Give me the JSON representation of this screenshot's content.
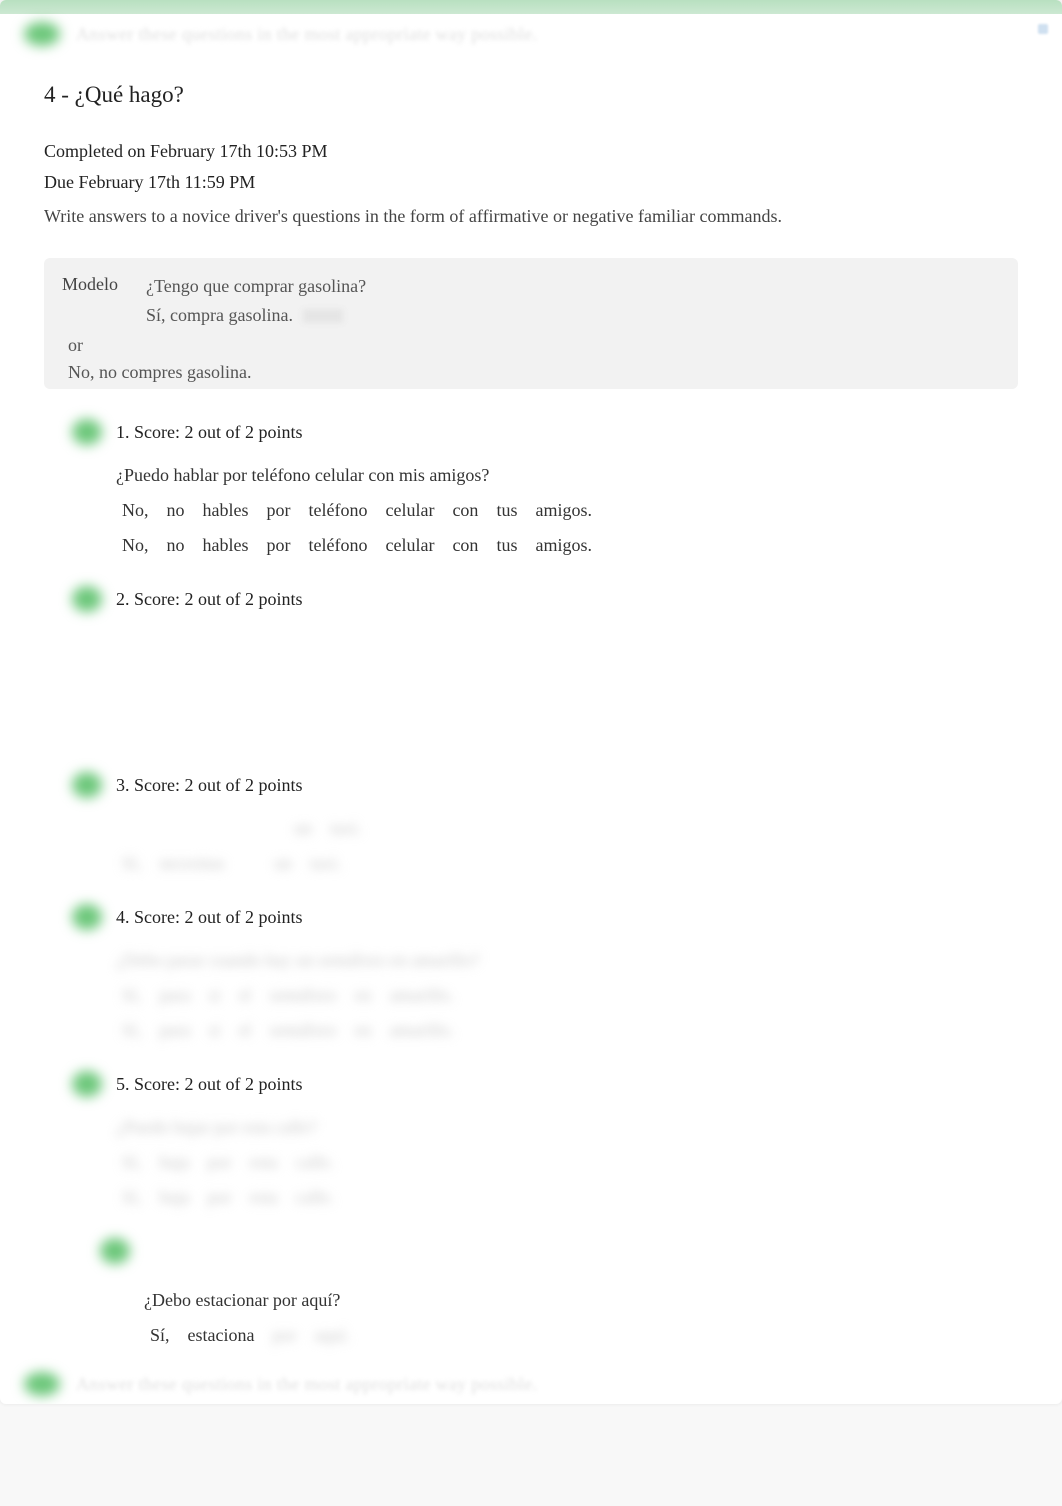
{
  "banner": {
    "text1": "Answer these questions in the most appropriate way possible.",
    "text2": "Answer these questions in the most appropriate way possible."
  },
  "title": "4 - ¿Qué hago?",
  "meta": {
    "completed": "Completed on February 17th 10:53 PM",
    "due": "Due February 17th 11:59 PM",
    "instructions": "Write answers to a novice driver's questions in the form of affirmative or negative familiar commands."
  },
  "modelo": {
    "label": "Modelo",
    "question": "¿Tengo que comprar gasolina?",
    "aff": "Sí, compra gasolina.",
    "or": "or",
    "neg": "No, no compres gasolina."
  },
  "questions": [
    {
      "num": "1.",
      "score": "Score: 2 out of 2 points",
      "prompt": "¿Puedo hablar por teléfono celular con mis amigos?",
      "answers": [
        [
          "No,",
          "no",
          "hables",
          "por",
          "teléfono",
          "celular",
          "con",
          "tus",
          "amigos."
        ],
        [
          "No,",
          "no",
          "hables",
          "por",
          "teléfono",
          "celular",
          "con",
          "tus",
          "amigos."
        ]
      ],
      "blurred_prompt": false,
      "blurred_answers": false
    },
    {
      "num": "2.",
      "score": "Score: 2 out of 2 points",
      "prompt": "",
      "answers": [],
      "blurred_prompt": false,
      "blurred_answers": false,
      "spacer": true
    },
    {
      "num": "3.",
      "score": "Score: 2 out of 2 points",
      "prompt": "",
      "answers": [
        [
          "",
          "",
          "",
          "",
          "un",
          "taxi."
        ],
        [
          "Sí,",
          "necesitas",
          "",
          "un",
          "taxi."
        ]
      ],
      "blurred_prompt": true,
      "blurred_answers": true,
      "leading_blur": true
    },
    {
      "num": "4.",
      "score": "Score: 2 out of 2 points",
      "prompt": "¿Debo parar cuando hay un semáforo en amarillo?",
      "answers": [
        [
          "Sí,",
          "para",
          "si",
          "el",
          "semáforo",
          "en",
          "amarillo."
        ],
        [
          "Sí,",
          "para",
          "si",
          "el",
          "semáforo",
          "en",
          "amarillo."
        ]
      ],
      "blurred_prompt": true,
      "blurred_answers": true
    },
    {
      "num": "5.",
      "score": "Score: 2 out of 2 points",
      "prompt": "¿Puedo bajar por esta calle?",
      "answers": [
        [
          "Sí,",
          "baja",
          "por",
          "esta",
          "calle."
        ],
        [
          "Sí,",
          "baja",
          "por",
          "esta",
          "calle."
        ]
      ],
      "blurred_prompt": true,
      "blurred_answers": true
    }
  ],
  "final": {
    "prompt": "¿Debo estacionar por aquí?",
    "answer_clear": [
      "Sí,",
      "estaciona"
    ],
    "answer_blur": [
      "por",
      "aquí."
    ]
  }
}
